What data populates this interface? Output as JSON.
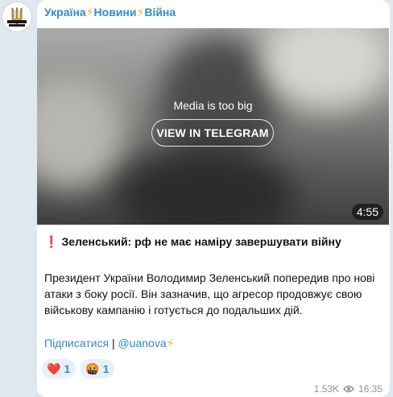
{
  "channel": {
    "name_part1": "Україна",
    "name_part2": "Новини",
    "name_part3": "Війна",
    "bolt": "⚡",
    "avatar_icon": "ukraine-trident-logo"
  },
  "media": {
    "message": "Media is too big",
    "button_label": "VIEW IN TELEGRAM",
    "duration": "4:55"
  },
  "post": {
    "headline_mark": "❗",
    "headline": "Зеленський: рф не має наміру завершувати війну",
    "body": "Президент України Володимир Зеленський попередив про нові атаки з боку росії. Він зазначив, що агресор продовжує свою військову кампанію і готується до подальших дій.",
    "subscribe_label": "Підписатися",
    "separator": "|",
    "handle": "@uanova",
    "handle_bolt": "⚡"
  },
  "reactions": [
    {
      "emoji": "❤️",
      "count": "1"
    },
    {
      "emoji": "🤬",
      "count": "1"
    }
  ],
  "meta": {
    "views": "1.53K",
    "time": "16:35",
    "views_icon": "eye-icon"
  },
  "colors": {
    "link": "#2f8ccf",
    "bolt": "#f2b01e",
    "page_bg": "#dfe8ee",
    "bubble_bg": "#ffffff"
  }
}
